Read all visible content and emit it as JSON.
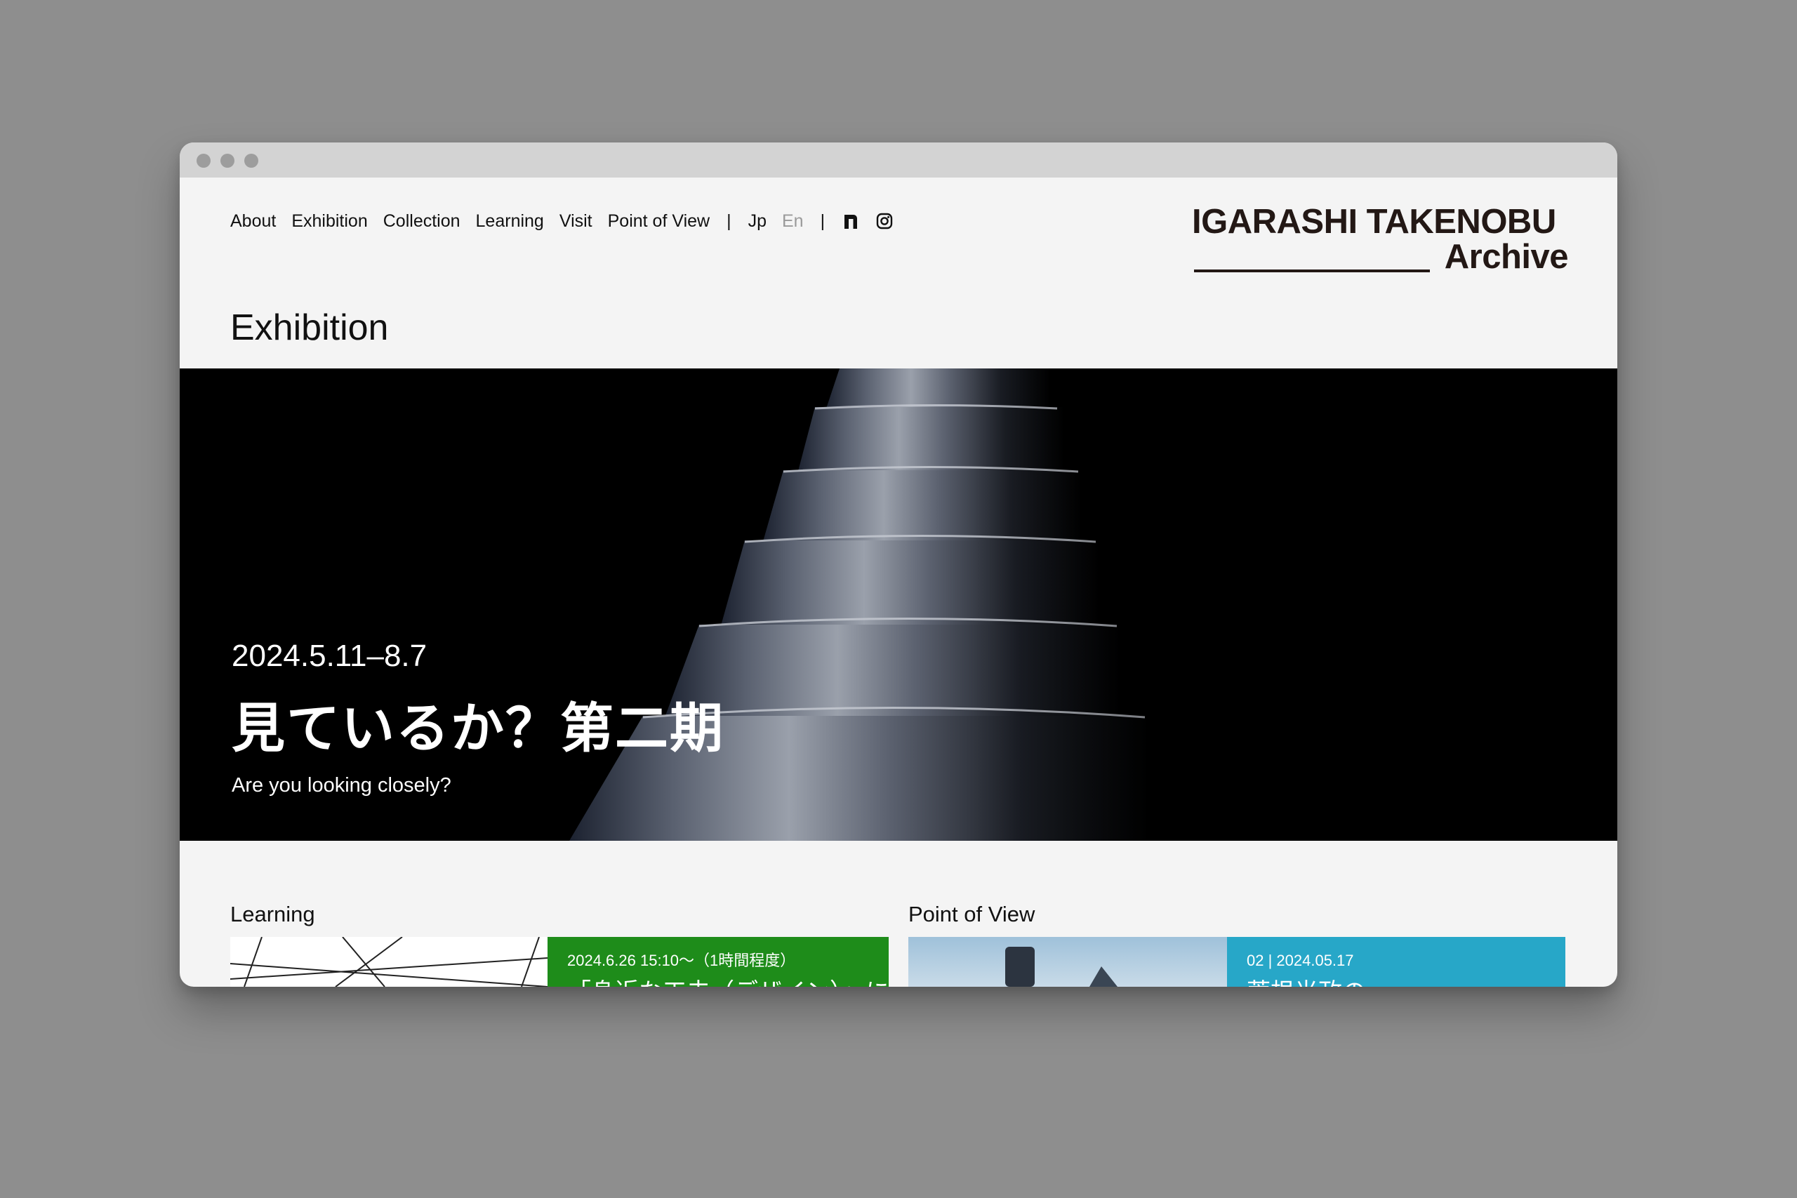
{
  "nav": {
    "items": [
      "About",
      "Exhibition",
      "Collection",
      "Learning",
      "Visit",
      "Point of View"
    ],
    "separator": "|",
    "lang_jp": "Jp",
    "lang_en": "En",
    "icons": [
      "note-icon",
      "instagram-icon"
    ]
  },
  "logo": {
    "line1": "IGARASHI TAKENOBU",
    "line2": "Archive"
  },
  "page_title": "Exhibition",
  "hero": {
    "date": "2024.5.11–8.7",
    "title_jp": "見ているか？第二期",
    "title_en": "Are you looking closely?"
  },
  "learning": {
    "label": "Learning",
    "meta": "2024.6.26 15:10〜（1時間程度）",
    "heading": "「身近な工夫（デザイン）」に",
    "accent": "#1e8c1a"
  },
  "point_of_view": {
    "label": "Point of View",
    "meta": "02 | 2024.05.17",
    "heading": "菅根光政の",
    "accent": "#27a7c8"
  }
}
